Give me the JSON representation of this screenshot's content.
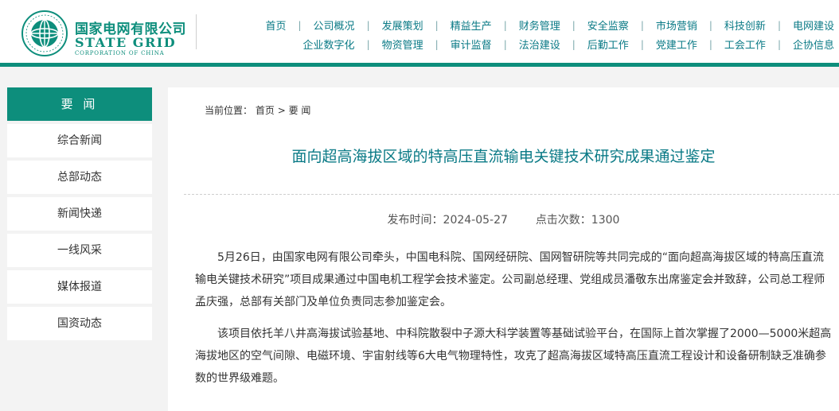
{
  "colors": {
    "brand": "#0d8e7c",
    "nav_text": "#0a7a86",
    "page_bg": "#f3f3f3"
  },
  "logo": {
    "cn_name": "国家电网有限公司",
    "en_name": "STATE GRID",
    "en_sub": "CORPORATION OF CHINA",
    "emblem_icon": "state-grid-emblem-icon"
  },
  "nav": {
    "row1": [
      "首页",
      "公司概况",
      "发展策划",
      "精益生产",
      "财务管理",
      "安全监察",
      "市场营销",
      "科技创新",
      "电网建设"
    ],
    "row2": [
      "企业数字化",
      "物资管理",
      "审计监督",
      "法治建设",
      "后勤工作",
      "党建工作",
      "工会工作",
      "企协信息"
    ]
  },
  "sidebar": {
    "title": "要 闻",
    "items": [
      "综合新闻",
      "总部动态",
      "新闻快递",
      "一线风采",
      "媒体报道",
      "国资动态"
    ]
  },
  "breadcrumb": {
    "prefix": "当前位置：",
    "home": "首页",
    "separator": ">",
    "current": "要 闻"
  },
  "article": {
    "title": "面向超高海拔区域的特高压直流输电关键技术研究成果通过鉴定",
    "publish_time": "发布时间：2024-05-27",
    "views": "点击次数：1300",
    "paragraphs": [
      "5月26日，由国家电网有限公司牵头，中国电科院、国网经研院、国网智研院等共同完成的“面向超高海拔区域的特高压直流输电关键技术研究”项目成果通过中国电机工程学会技术鉴定。公司副总经理、党组成员潘敬东出席鉴定会并致辞，公司总工程师孟庆强，总部有关部门及单位负责同志参加鉴定会。",
      "该项目依托羊八井高海拔试验基地、中科院散裂中子源大科学装置等基础试验平台，在国际上首次掌握了2000—5000米超高海拔地区的空气间隙、电磁环境、宇宙射线等6大电气物理特性，攻克了超高海拔区域特高压直流工程设计和设备研制缺乏准确参数的世界级难题。"
    ]
  }
}
